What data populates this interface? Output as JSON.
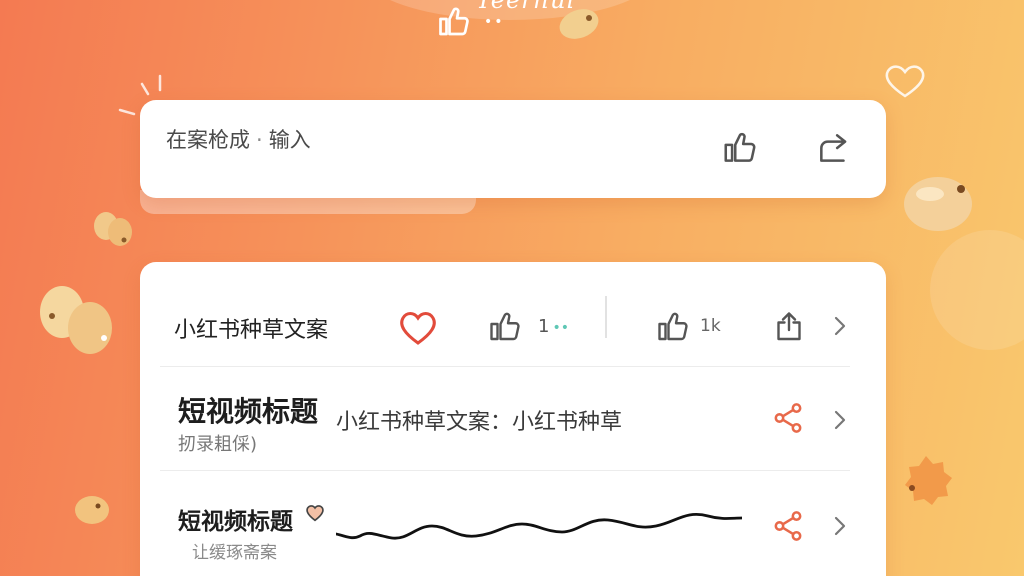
{
  "header": {
    "logo_script": "Yeerhui",
    "logo_icon": "thumbs-up-icon"
  },
  "input_card": {
    "placeholder_prefix": "在案枪成",
    "placeholder_sep": "·",
    "placeholder_text": "输入",
    "like_icon": "thumbs-up-icon",
    "share_icon": "share-arrow-icon"
  },
  "list": {
    "rows": [
      {
        "title": "小红书种草文案",
        "heart_icon": "heart-outline-icon",
        "like_count": "1",
        "like_count_2": "1k",
        "share_icon": "share-box-icon"
      },
      {
        "title": "短视频标题",
        "subtitle": "扨录耝倸)",
        "content": "小红书种草文案：小红书种草",
        "share_icon": "share-nodes-icon"
      },
      {
        "title": "短视频标题",
        "subtitle": "让缓琢斋案",
        "share_icon": "share-nodes-icon"
      }
    ]
  },
  "colors": {
    "bg_start": "#f47a52",
    "bg_end": "#f9c86d",
    "accent_red": "#e24b3b",
    "share_orange": "#e8694a"
  }
}
